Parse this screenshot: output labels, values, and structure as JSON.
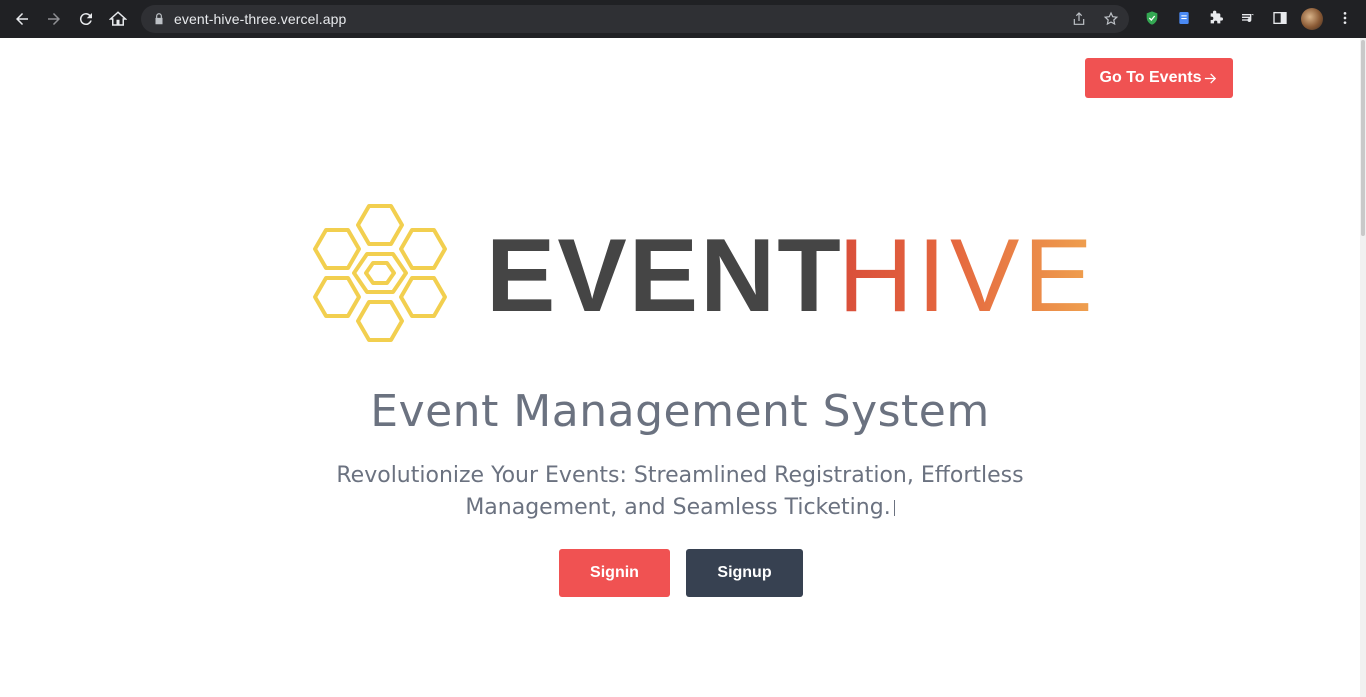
{
  "browser": {
    "url": "event-hive-three.vercel.app",
    "nav_icons": [
      "back-icon",
      "forward-icon",
      "reload-icon",
      "home-icon"
    ],
    "toolbar_icons": [
      "share-icon",
      "bookmark-star-icon",
      "shield-extension-icon",
      "docs-extension-icon",
      "puzzle-extensions-icon",
      "media-control-icon",
      "side-panel-icon",
      "profile-avatar",
      "kebab-menu-icon"
    ]
  },
  "header": {
    "goto_events_label": "Go To Events"
  },
  "logo": {
    "word_dark": "EVENT",
    "word_gradient": "HIVE",
    "dark_color": "#454545",
    "gradient_colors": [
      "#d94e3a",
      "#e5683f",
      "#efa24f"
    ],
    "honeycomb_color": "#f2cf4f"
  },
  "hero": {
    "title": "Event Management System",
    "subtitle": "Revolutionize Your Events: Streamlined Registration, Effortless Management, and Seamless Ticketing."
  },
  "actions": {
    "signin_label": "Signin",
    "signup_label": "Signup"
  },
  "colors": {
    "accent_red": "#f05252",
    "dark_button": "#374151",
    "text_gray": "#6b7280"
  }
}
